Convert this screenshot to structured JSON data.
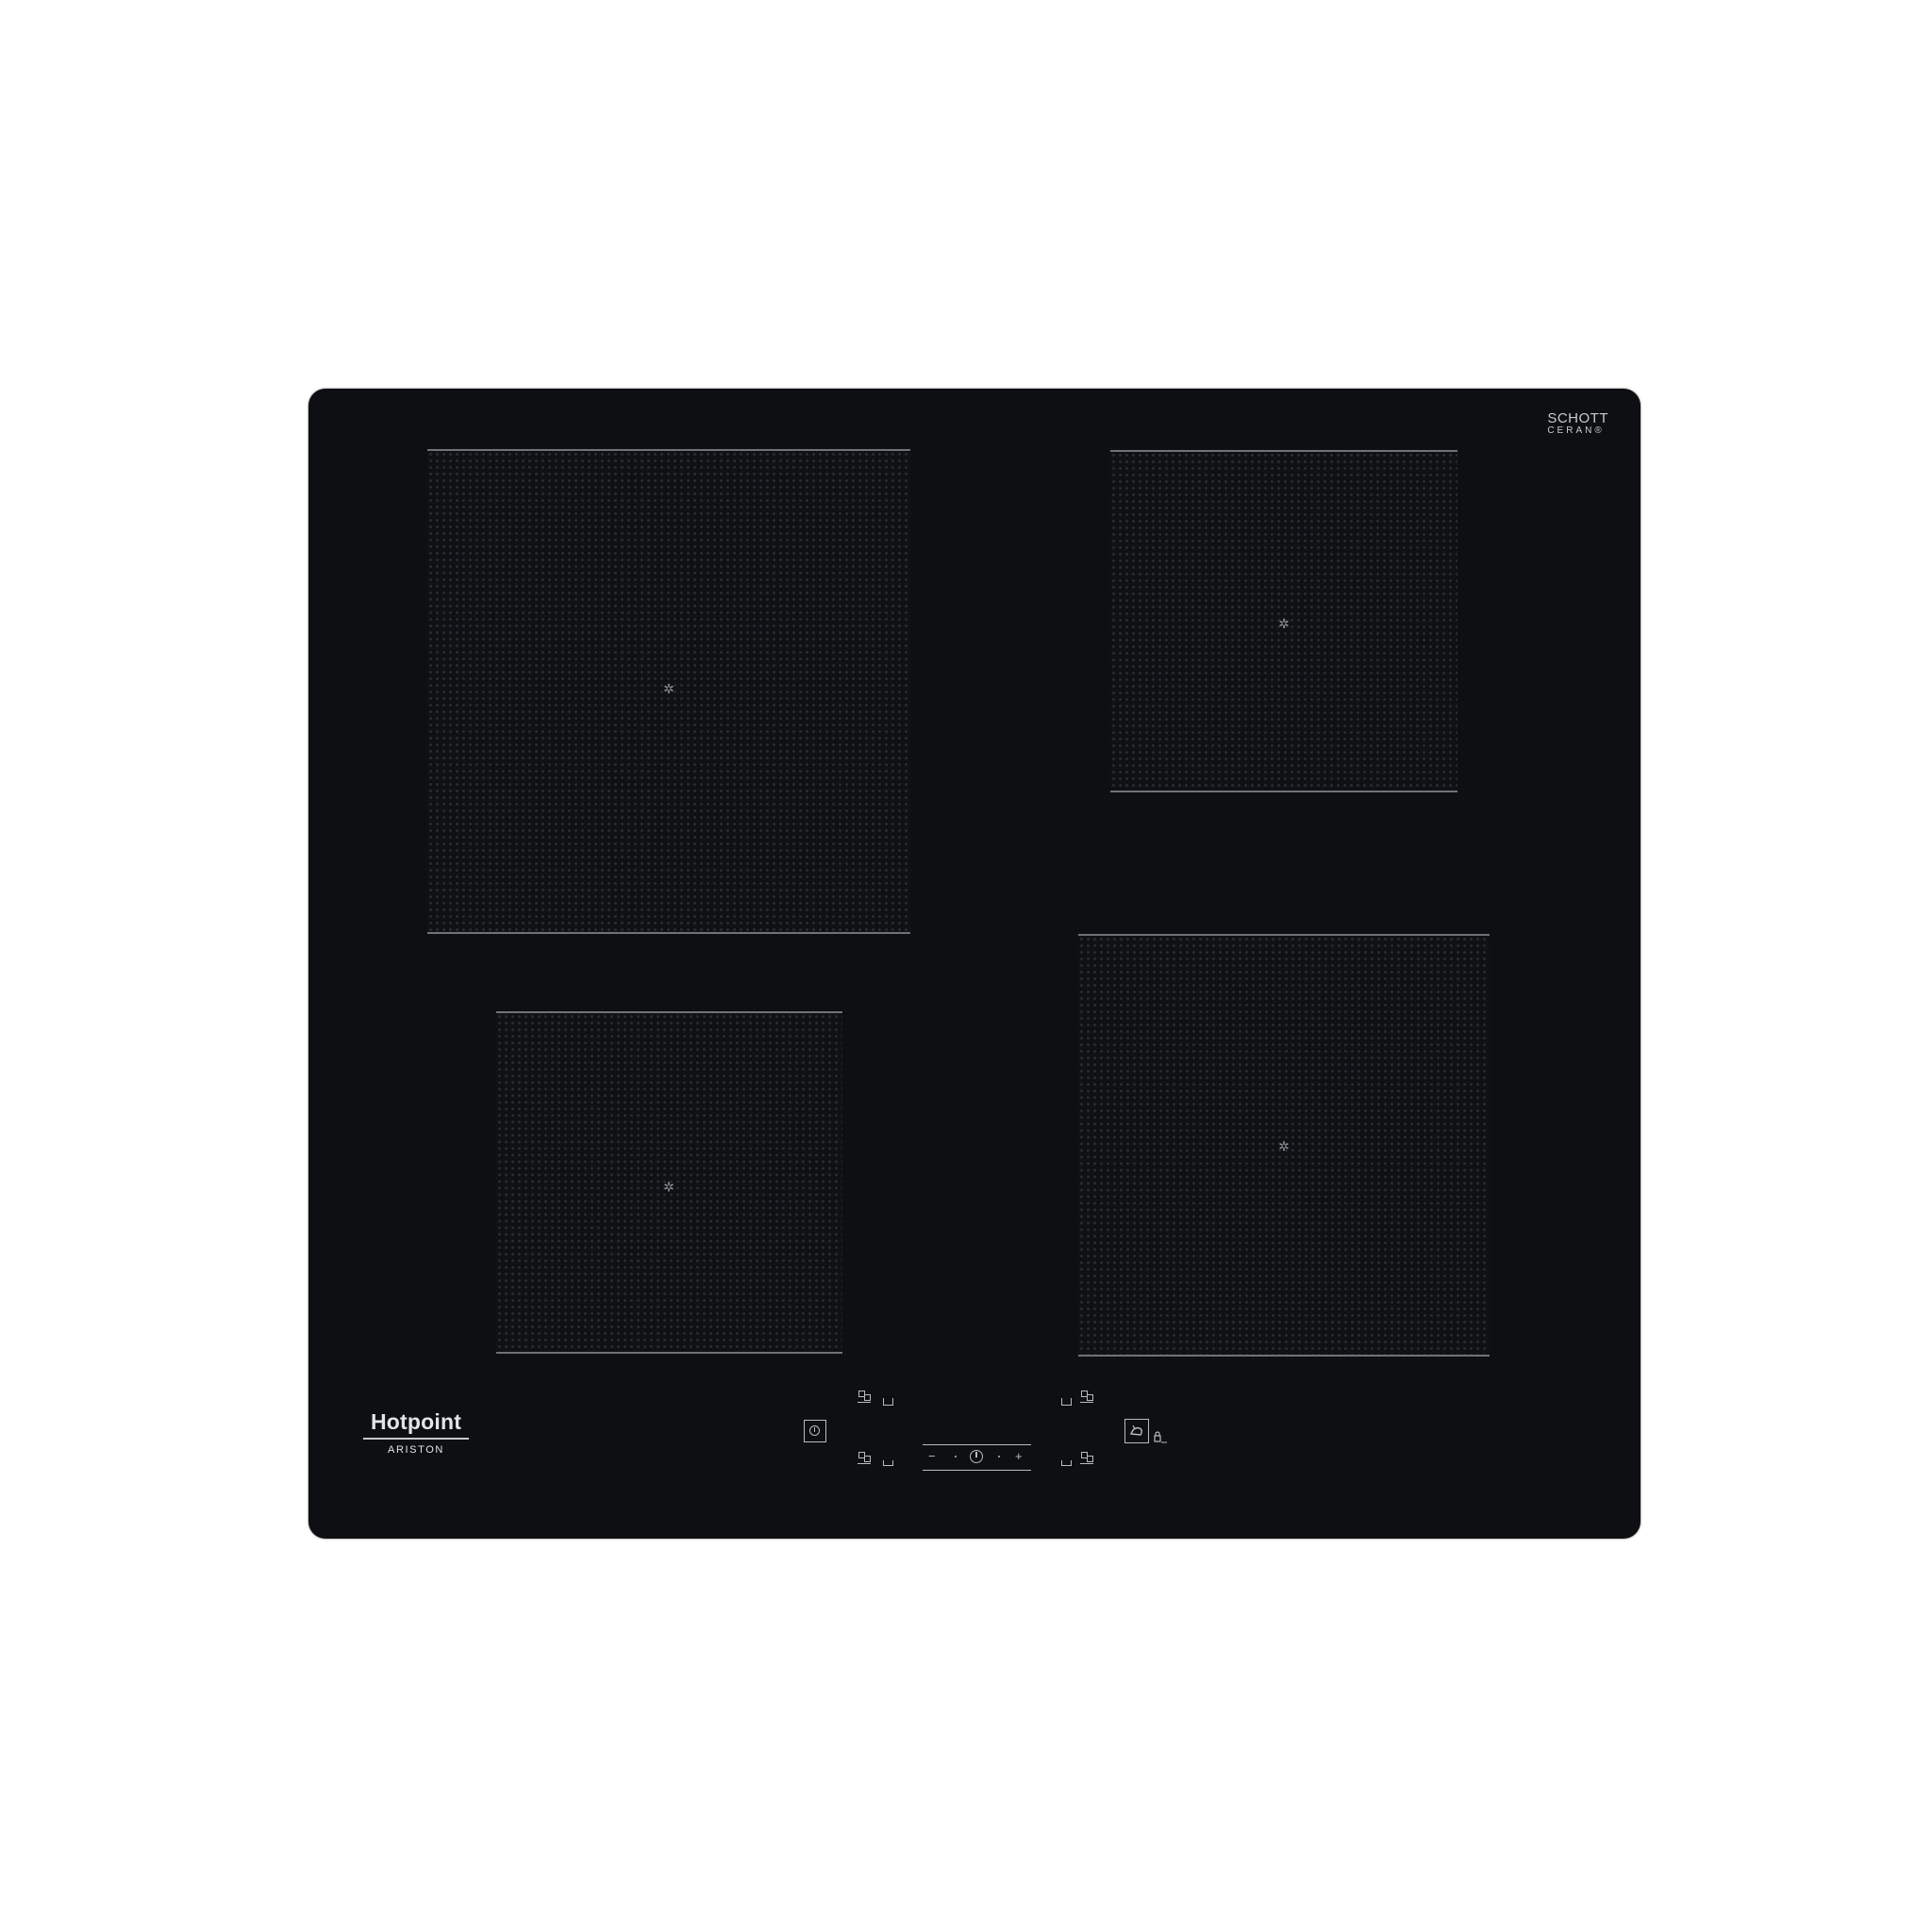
{
  "hob": {
    "badge": {
      "line1": "SCHOTT",
      "line2": "CERAN®"
    },
    "brand": {
      "name": "Hotpoint",
      "sub": "ARISTON"
    },
    "zones": [
      "front-left",
      "rear-left",
      "rear-right",
      "front-right"
    ],
    "controls": {
      "minus_symbol": "−",
      "plus_symbol": "+"
    },
    "colors": {
      "glass": "#0e0f12",
      "marking": "#b9bbbf",
      "background": "#ffffff"
    }
  }
}
